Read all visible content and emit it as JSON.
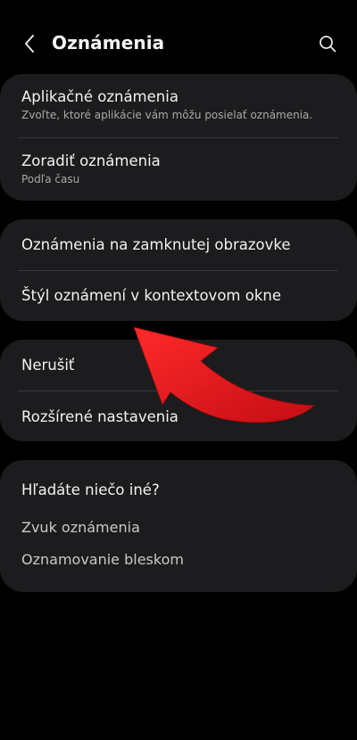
{
  "header": {
    "back_icon": "back-chevron-icon",
    "title": "Oznámenia",
    "search_icon": "search-icon"
  },
  "group1": {
    "items": [
      {
        "title": "Aplikačné oznámenia",
        "subtitle": "Zvoľte, ktoré aplikácie vám môžu posielať oznámenia."
      },
      {
        "title": "Zoradiť oznámenia",
        "subtitle": "Podľa času"
      }
    ]
  },
  "group2": {
    "items": [
      {
        "title": "Oznámenia na zamknutej obrazovke"
      },
      {
        "title": "Štýl oznámení v kontextovom okne"
      }
    ]
  },
  "group3": {
    "items": [
      {
        "title": "Nerušiť"
      },
      {
        "title": "Rozšírené nastavenia"
      }
    ]
  },
  "suggestions": {
    "heading": "Hľadáte niečo iné?",
    "links": [
      "Zvuk oznámenia",
      "Oznamovanie bleskom"
    ]
  },
  "colors": {
    "background": "#000000",
    "card": "#1c1c1e",
    "annotation_arrow": "#e0161e"
  }
}
